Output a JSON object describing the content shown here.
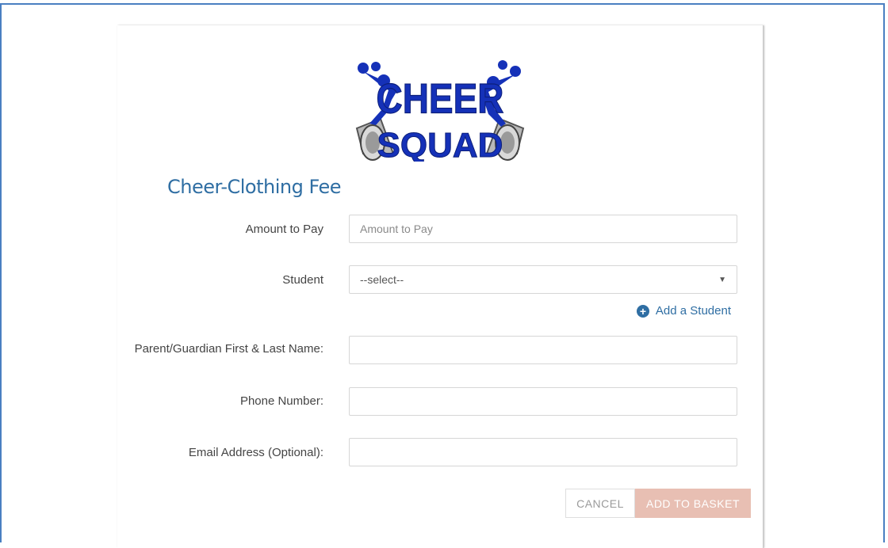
{
  "page": {
    "title": "Cheer-Clothing Fee"
  },
  "logo": {
    "text_line1": "CHEER",
    "text_line2": "SQUAD",
    "color": "#1531b8"
  },
  "form": {
    "amount": {
      "label": "Amount to Pay",
      "placeholder": "Amount to Pay",
      "value": ""
    },
    "student": {
      "label": "Student",
      "selected": "--select--"
    },
    "add_student_label": "Add a Student",
    "parent": {
      "label": "Parent/Guardian First & Last Name:",
      "value": ""
    },
    "phone": {
      "label": "Phone Number:",
      "value": ""
    },
    "email": {
      "label": "Email Address (Optional):",
      "value": ""
    }
  },
  "actions": {
    "cancel_label": "CANCEL",
    "add_label": "ADD TO BASKET"
  },
  "colors": {
    "accent": "#2f6ea3",
    "add_button": "#e8bfb3",
    "frame": "#4a7fc1"
  }
}
